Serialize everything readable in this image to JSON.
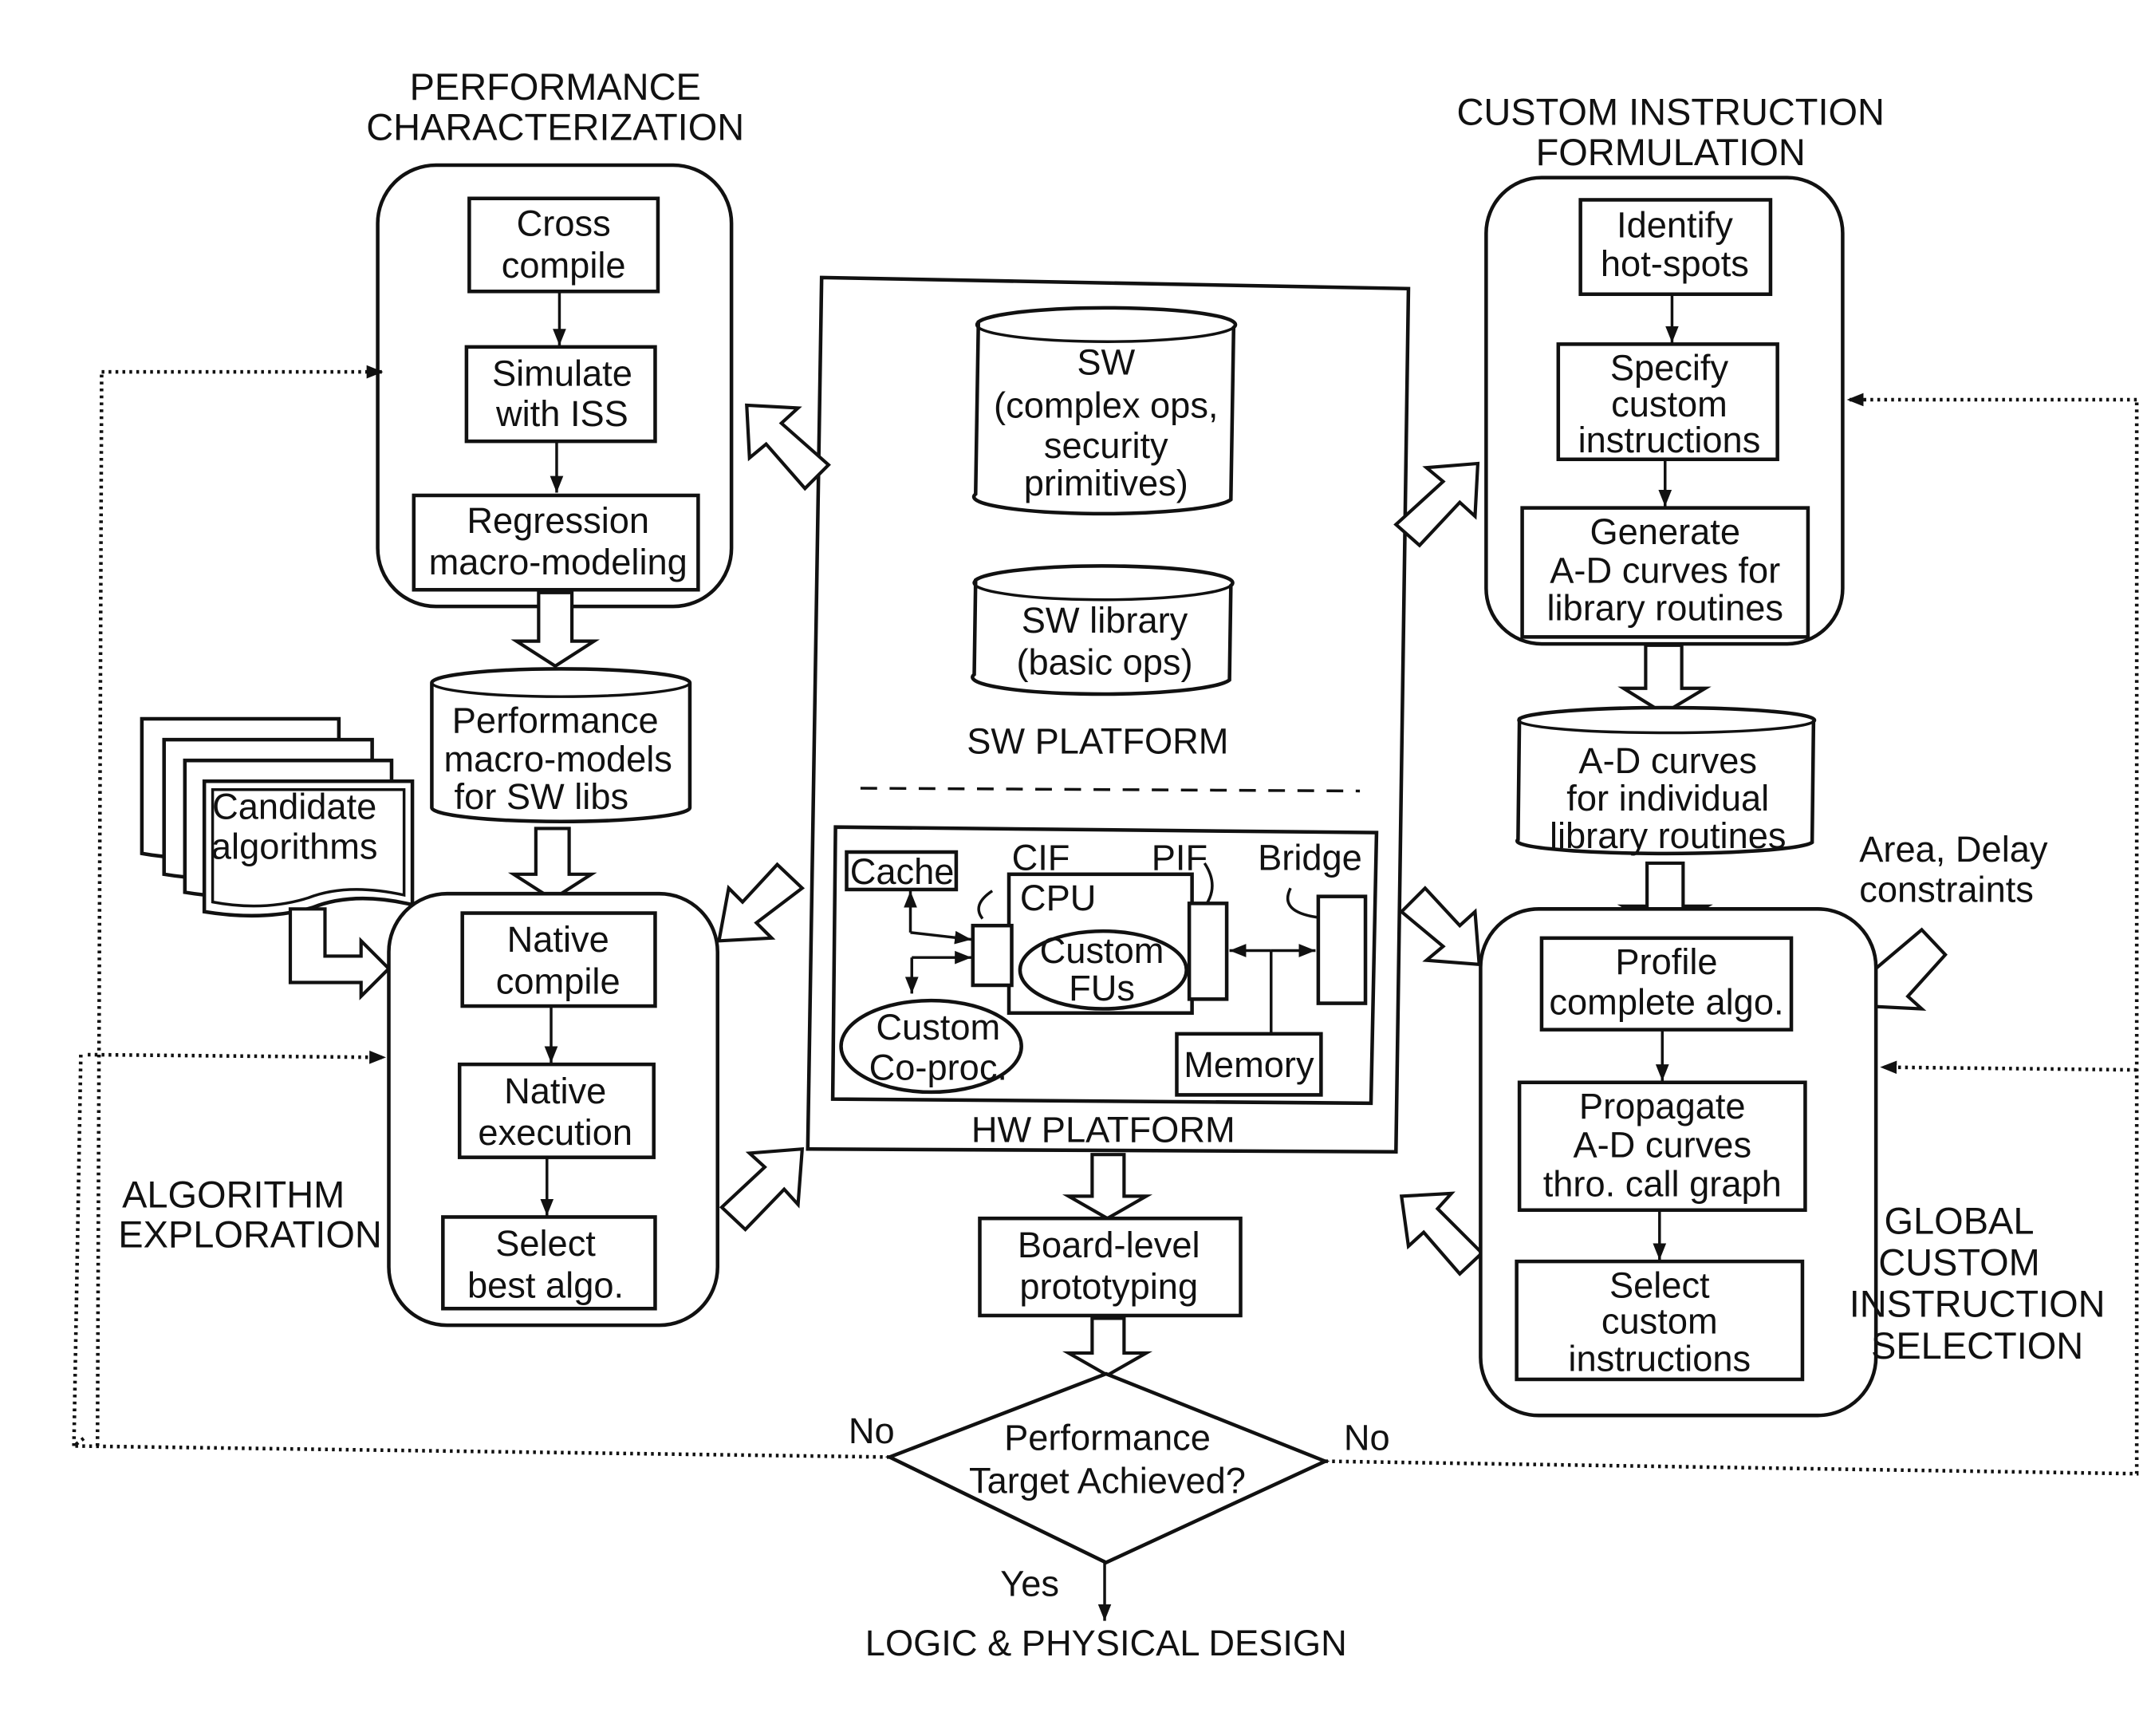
{
  "sections": {
    "performance_characterization": {
      "title": [
        "PERFORMANCE",
        "CHARACTERIZATION"
      ],
      "steps": [
        {
          "lines": [
            "Cross",
            "compile"
          ]
        },
        {
          "lines": [
            "Simulate",
            "with ISS"
          ]
        },
        {
          "lines": [
            "Regression",
            "macro-modeling"
          ]
        }
      ]
    },
    "algorithm_exploration": {
      "title": [
        "ALGORITHM",
        "EXPLORATION"
      ],
      "steps": [
        {
          "lines": [
            "Native",
            "compile"
          ]
        },
        {
          "lines": [
            "Native",
            "execution"
          ]
        },
        {
          "lines": [
            "Select",
            "best algo."
          ]
        }
      ]
    },
    "custom_instruction_formulation": {
      "title": [
        "CUSTOM INSTRUCTION",
        "FORMULATION"
      ],
      "steps": [
        {
          "lines": [
            "Identify",
            "hot-spots"
          ]
        },
        {
          "lines": [
            "Specify",
            "custom",
            "instructions"
          ]
        },
        {
          "lines": [
            "Generate",
            "A-D curves for",
            "library routines"
          ]
        }
      ]
    },
    "global_custom_instruction_selection": {
      "title": [
        "GLOBAL",
        "CUSTOM",
        "INSTRUCTION",
        "SELECTION"
      ],
      "steps": [
        {
          "lines": [
            "Profile",
            "complete algo."
          ]
        },
        {
          "lines": [
            "Propagate",
            "A-D curves",
            "thro. call graph"
          ]
        },
        {
          "lines": [
            "Select",
            "custom",
            "instructions"
          ]
        }
      ]
    }
  },
  "databases": {
    "perf_macro_models": [
      "Performance",
      "macro-models",
      "for SW libs"
    ],
    "ad_curves": [
      "A-D curves",
      "for individual",
      "library routines"
    ],
    "sw_complex": [
      "SW",
      "(complex ops,",
      "security",
      "primitives)"
    ],
    "sw_library": [
      "SW library",
      "(basic ops)"
    ]
  },
  "candidate_algorithms": [
    "Candidate",
    "algorithms"
  ],
  "constraints": [
    "Area, Delay",
    "constraints"
  ],
  "platform": {
    "sw_label": "SW PLATFORM",
    "hw_label": "HW PLATFORM",
    "hw": {
      "cache": "Cache",
      "cif": "CIF",
      "pif": "PIF",
      "cpu": "CPU",
      "custom_fus": [
        "Custom",
        "FUs"
      ],
      "bridge": "Bridge",
      "coproc": [
        "Custom",
        "Co-proc."
      ],
      "memory": "Memory"
    }
  },
  "board_level": [
    "Board-level",
    "prototyping"
  ],
  "decision": {
    "lines": [
      "Performance",
      "Target Achieved?"
    ],
    "no_left": "No",
    "no_right": "No",
    "yes": "Yes"
  },
  "final_step": "LOGIC & PHYSICAL DESIGN"
}
